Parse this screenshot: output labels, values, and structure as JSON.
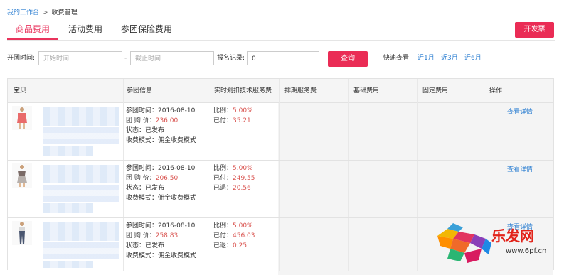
{
  "breadcrumb": {
    "home": "我的工作台",
    "sep": ">",
    "current": "收费管理"
  },
  "tabs": [
    {
      "label": "商品费用",
      "active": true
    },
    {
      "label": "活动费用",
      "active": false
    },
    {
      "label": "参团保险费用",
      "active": false
    }
  ],
  "invoice_button": "开发票",
  "filters": {
    "group_time_label": "开团时间:",
    "start_placeholder": "开始时间",
    "range_sep": "-",
    "end_placeholder": "截止时间",
    "signup_label": "报名记录:",
    "signup_value": "0",
    "query_button": "查询",
    "quick_label": "快速查看:",
    "quick_links": [
      "近1月",
      "近3月",
      "近6月"
    ]
  },
  "table": {
    "headers": [
      "宝贝",
      "参团信息",
      "实时划扣技术服务费",
      "排期服务费",
      "基础费用",
      "固定费用",
      "操作"
    ],
    "rows": [
      {
        "time": "参团时间：2016-08-10",
        "price_label": "团 购 价：",
        "price": "236.00",
        "status": "状态：已发布",
        "mode": "收费模式：佣金收费模式",
        "ratio_label": "比例：",
        "ratio": "5.00%",
        "paid_label": "已付：",
        "paid": "35.21",
        "refund_label": "",
        "refund": "",
        "action": "查看详情"
      },
      {
        "time": "参团时间：2016-08-10",
        "price_label": "团 购 价：",
        "price": "206.50",
        "status": "状态：已发布",
        "mode": "收费模式：佣金收费模式",
        "ratio_label": "比例：",
        "ratio": "5.00%",
        "paid_label": "已付：",
        "paid": "249.55",
        "refund_label": "已退：",
        "refund": "20.56",
        "action": "查看详情"
      },
      {
        "time": "参团时间：2016-08-10",
        "price_label": "团 购 价：",
        "price": "258.83",
        "status": "状态：已发布",
        "mode": "收费模式：佣金收费模式",
        "ratio_label": "比例：",
        "ratio": "5.00%",
        "paid_label": "已付：",
        "paid": "456.03",
        "refund_label": "已退：",
        "refund": "0.25",
        "action": "查看详情"
      }
    ]
  },
  "watermark": {
    "brand": "乐发网",
    "url": "www.6pf.cn"
  },
  "colors": {
    "accent": "#e9335c",
    "link": "#2d7fd2",
    "value_red": "#d9534f"
  }
}
